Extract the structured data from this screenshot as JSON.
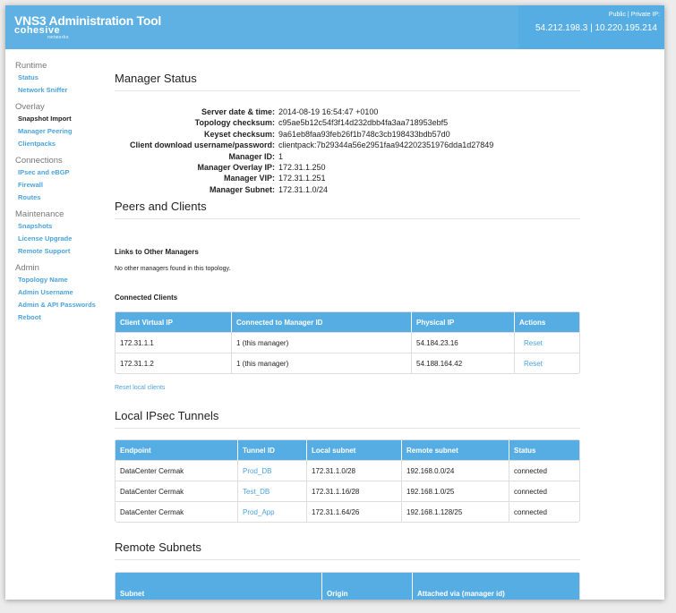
{
  "header": {
    "title": "VNS3 Administration Tool",
    "logo": "cohesive",
    "logo_sub": "networks",
    "ip_label": "Public | Private IP:",
    "ip_value": "54.212.198.3 | 10.220.195.214"
  },
  "sidebar": [
    {
      "heading": "Runtime",
      "items": [
        {
          "label": "Status"
        },
        {
          "label": "Network Sniffer"
        }
      ]
    },
    {
      "heading": "Overlay",
      "items": [
        {
          "label": "Snapshot Import",
          "active": true
        },
        {
          "label": "Manager Peering"
        },
        {
          "label": "Clientpacks"
        }
      ]
    },
    {
      "heading": "Connections",
      "items": [
        {
          "label": "IPsec and eBGP"
        },
        {
          "label": "Firewall"
        },
        {
          "label": "Routes"
        }
      ]
    },
    {
      "heading": "Maintenance",
      "items": [
        {
          "label": "Snapshots"
        },
        {
          "label": "License Upgrade"
        },
        {
          "label": "Remote Support"
        }
      ]
    },
    {
      "heading": "Admin",
      "items": [
        {
          "label": "Topology Name"
        },
        {
          "label": "Admin Username"
        },
        {
          "label": "Admin & API Passwords"
        },
        {
          "label": "Reboot"
        }
      ]
    }
  ],
  "manager_status": {
    "title": "Manager Status",
    "fields": [
      {
        "label": "Server date & time:",
        "value": "2014-08-19 16:54:47 +0100"
      },
      {
        "label": "Topology checksum:",
        "value": "c95ae5b12c54f3f14d232dbb4fa3aa718953ebf5"
      },
      {
        "label": "Keyset checksum:",
        "value": "9a61eb8faa93feb26f1b748c3cb198433bdb57d0"
      },
      {
        "label": "Client download username/password:",
        "value": "clientpack:7b29344a56e2951faa942202351976dda1d27849"
      },
      {
        "label": "Manager ID:",
        "value": "1"
      },
      {
        "label": "Manager Overlay IP:",
        "value": "172.31.1.250"
      },
      {
        "label": "Manager VIP:",
        "value": "172.31.1.251"
      },
      {
        "label": "Manager Subnet:",
        "value": "172.31.1.0/24"
      }
    ]
  },
  "peers": {
    "title": "Peers and Clients",
    "links_title": "Links to Other Managers",
    "links_text": "No other managers found in this topology.",
    "clients_title": "Connected Clients",
    "columns": [
      "Client Virtual IP",
      "Connected to Manager ID",
      "Physical IP",
      "Actions"
    ],
    "rows": [
      [
        "172.31.1.1",
        "1 (this manager)",
        "54.184.23.16",
        "Reset"
      ],
      [
        "172.31.1.2",
        "1 (this manager)",
        "54.188.164.42",
        "Reset"
      ]
    ],
    "reset_all": "Reset local clients"
  },
  "ipsec": {
    "title": "Local IPsec Tunnels",
    "columns": [
      "Endpoint",
      "Tunnel ID",
      "Local subnet",
      "Remote subnet",
      "Status"
    ],
    "rows": [
      [
        "DataCenter Cermak",
        "Prod_DB",
        "172.31.1.0/28",
        "192.168.0.0/24",
        "connected"
      ],
      [
        "DataCenter Cermak",
        "Test_DB",
        "172.31.1.16/28",
        "192.168.1.0/25",
        "connected"
      ],
      [
        "DataCenter Cermak",
        "Prod_App",
        "172.31.1.64/26",
        "192.168.1.128/25",
        "connected"
      ]
    ]
  },
  "remote": {
    "title": "Remote Subnets",
    "columns": [
      "Subnet",
      "Origin",
      "Attached via (manager id)"
    ]
  },
  "colors": {
    "header": "#5eb1e2",
    "link": "#4aa3dd"
  }
}
